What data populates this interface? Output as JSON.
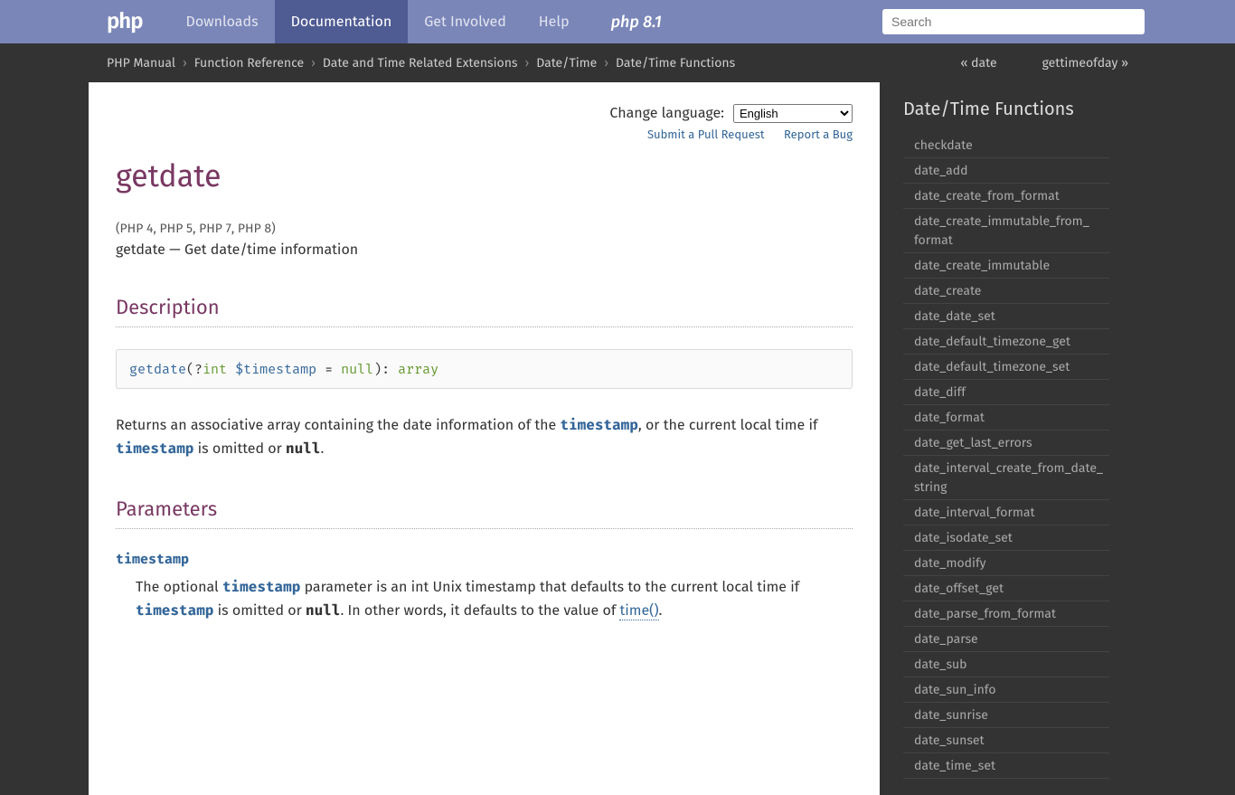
{
  "nav": {
    "logo": "php",
    "items": [
      "Downloads",
      "Documentation",
      "Get Involved",
      "Help"
    ],
    "active_index": 1,
    "promo": "php 8.1",
    "search_placeholder": "Search"
  },
  "breadcrumb": {
    "items": [
      "PHP Manual",
      "Function Reference",
      "Date and Time Related Extensions",
      "Date/Time",
      "Date/Time Functions"
    ],
    "prev": "« date",
    "next": "gettimeofday »"
  },
  "page": {
    "lang_label": "Change language:",
    "lang_value": "English",
    "submit_pr": "Submit a Pull Request",
    "report_bug": "Report a Bug",
    "title": "getdate",
    "versions": "(PHP 4, PHP 5, PHP 7, PHP 8)",
    "summary": "getdate — Get date/time information",
    "sec_description": "Description",
    "synopsis": {
      "fn": "getdate",
      "open": "(",
      "qmark": "?",
      "ptype": "int",
      "pname": "$timestamp",
      "eq": " = ",
      "defv": "null",
      "close": "): ",
      "ret": "array"
    },
    "desc_p1_a": "Returns an associative array containing the date information of the ",
    "desc_p1_b": ", or the current local time if ",
    "desc_p1_c": " is omitted or ",
    "desc_p1_d": ".",
    "param_ts": "timestamp",
    "null_lit": "null",
    "sec_parameters": "Parameters",
    "param_name": "timestamp",
    "param_desc_a": "The optional ",
    "param_desc_b": " parameter is an int Unix timestamp that defaults to the current local time if ",
    "param_desc_c": " is omitted or ",
    "param_desc_d": ". In other words, it defaults to the value of ",
    "time_fn": "time()",
    "param_desc_e": "."
  },
  "sidebar": {
    "title": "Date/Time Functions",
    "items": [
      "checkdate",
      "date_add",
      "date_create_from_format",
      "date_create_immutable_from_format",
      "date_create_immutable",
      "date_create",
      "date_date_set",
      "date_default_timezone_get",
      "date_default_timezone_set",
      "date_diff",
      "date_format",
      "date_get_last_errors",
      "date_interval_create_from_date_string",
      "date_interval_format",
      "date_isodate_set",
      "date_modify",
      "date_offset_get",
      "date_parse_from_format",
      "date_parse",
      "date_sub",
      "date_sun_info",
      "date_sunrise",
      "date_sunset",
      "date_time_set"
    ]
  }
}
